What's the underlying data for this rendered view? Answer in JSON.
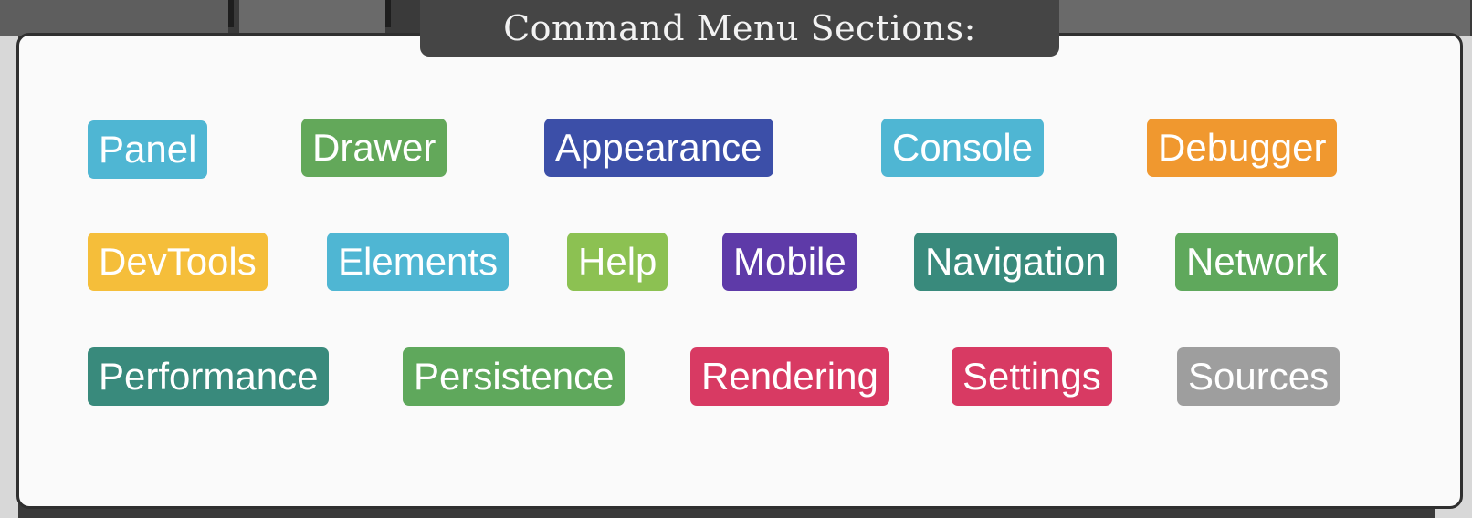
{
  "header": {
    "title": "Command Menu Sections:"
  },
  "sections": [
    {
      "id": "panel",
      "label": "Panel",
      "color": "#4fb6d3"
    },
    {
      "id": "drawer",
      "label": "Drawer",
      "color": "#63a85a"
    },
    {
      "id": "appearance",
      "label": "Appearance",
      "color": "#3c4fa8"
    },
    {
      "id": "console",
      "label": "Console",
      "color": "#4fb6d3"
    },
    {
      "id": "debugger",
      "label": "Debugger",
      "color": "#f0982f"
    },
    {
      "id": "devtools",
      "label": "DevTools",
      "color": "#f5be3a"
    },
    {
      "id": "elements",
      "label": "Elements",
      "color": "#4fb6d3"
    },
    {
      "id": "help",
      "label": "Help",
      "color": "#8cc152"
    },
    {
      "id": "mobile",
      "label": "Mobile",
      "color": "#5e3aa8"
    },
    {
      "id": "navigation",
      "label": "Navigation",
      "color": "#398a7c"
    },
    {
      "id": "network",
      "label": "Network",
      "color": "#5fa85c"
    },
    {
      "id": "performance",
      "label": "Performance",
      "color": "#398a7c"
    },
    {
      "id": "persistence",
      "label": "Persistence",
      "color": "#5fa85c"
    },
    {
      "id": "rendering",
      "label": "Rendering",
      "color": "#d83a63"
    },
    {
      "id": "settings",
      "label": "Settings",
      "color": "#d83a63"
    },
    {
      "id": "sources",
      "label": "Sources",
      "color": "#9e9e9e"
    }
  ]
}
